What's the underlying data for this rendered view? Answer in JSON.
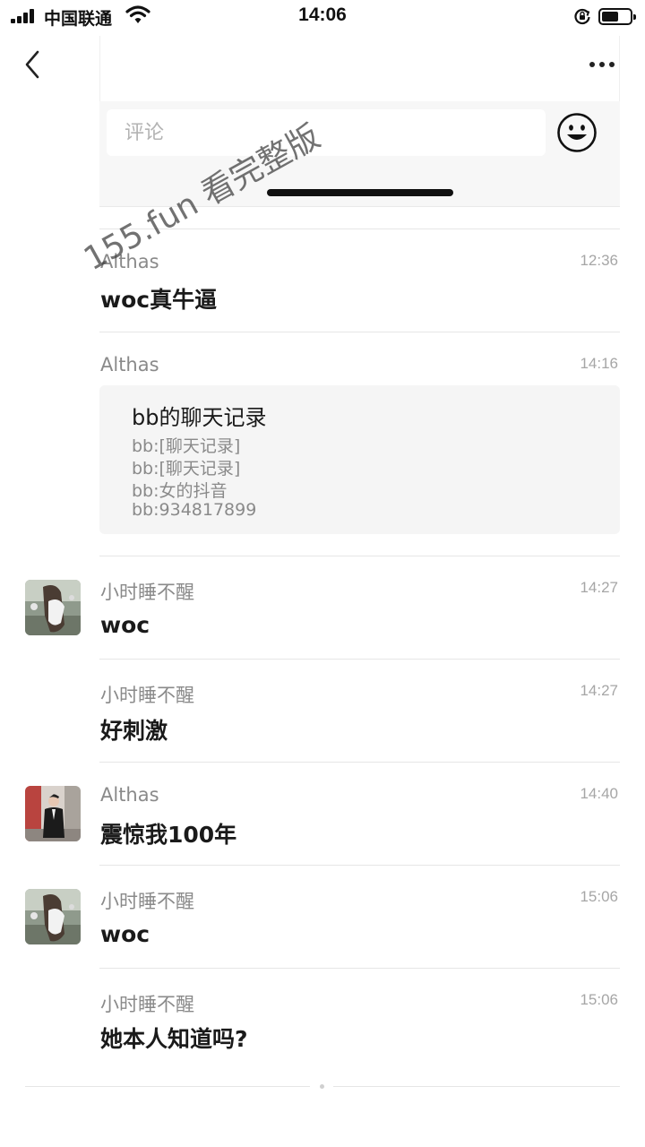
{
  "status_bar": {
    "carrier": "中国联通",
    "time": "14:06"
  },
  "header": {
    "back_icon": "chevron-left-icon",
    "more_icon": "more-dots-icon"
  },
  "comment": {
    "placeholder": "评论",
    "emoji_icon": "emoji-smile-icon"
  },
  "watermark": "155.fun 看完整版",
  "messages": [
    {
      "sender": "Althas",
      "time": "12:36",
      "text": "woc真牛逼",
      "avatar": false
    },
    {
      "sender": "Althas",
      "time": "14:16",
      "card": {
        "title": "bb的聊天记录",
        "lines": [
          "bb:[聊天记录]",
          "bb:[聊天记录]",
          "bb:女的抖音",
          "bb:934817899"
        ]
      },
      "avatar": false
    },
    {
      "sender": "小时睡不醒",
      "time": "14:27",
      "text": "woc",
      "avatar": true
    },
    {
      "sender": "小时睡不醒",
      "time": "14:27",
      "text": "好刺激",
      "avatar": false
    },
    {
      "sender": "Althas",
      "time": "14:40",
      "text": "震惊我100年",
      "avatar": true
    },
    {
      "sender": "小时睡不醒",
      "time": "15:06",
      "text": "woc",
      "avatar": true
    },
    {
      "sender": "小时睡不醒",
      "time": "15:06",
      "text": "她本人知道吗?",
      "avatar": false
    }
  ],
  "colors": {
    "sender": "#8a8a8a",
    "time": "#a6a6a6",
    "card_bg": "#f5f5f5",
    "divider": "#e6e6e6"
  }
}
